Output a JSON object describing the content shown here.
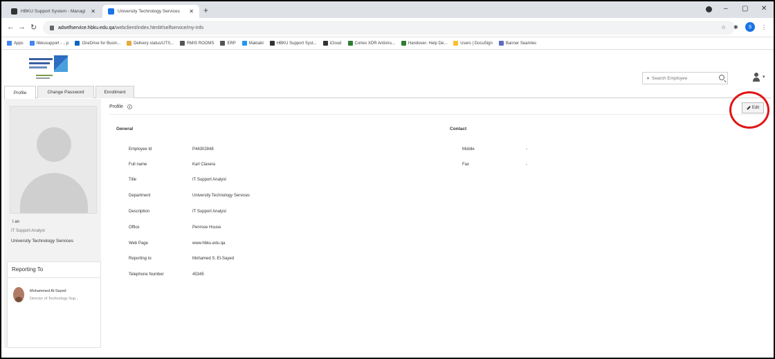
{
  "browser": {
    "tabs": [
      {
        "title": "HBKU Support System - Managi",
        "active": false,
        "favicon_color": "#333333"
      },
      {
        "title": "University Technology Services",
        "active": true,
        "favicon_color": "#1a73e8"
      }
    ],
    "new_tab": "+",
    "window_controls": {
      "minimize": "–",
      "maximize": "▢",
      "close": "✕"
    },
    "address": {
      "domain": "adselfservice.hbku.edu.qa",
      "path": "/webclient/index.html#/selfservice/my-info"
    },
    "account_initial": "S",
    "bookmarks": [
      {
        "label": "Apps",
        "color": "#4285f4"
      },
      {
        "label": "hbkusupport - ...p",
        "color": "#4285f4"
      },
      {
        "label": "OneDrive for Busin...",
        "color": "#0a66c2"
      },
      {
        "label": "Delivery status/UTS...",
        "color": "#e8a93a"
      },
      {
        "label": "RMIS ROOMS",
        "color": "#555555"
      },
      {
        "label": "ERP",
        "color": "#555555"
      },
      {
        "label": "Maktabi",
        "color": "#2196f3"
      },
      {
        "label": "HBKU Support Syst...",
        "color": "#333333"
      },
      {
        "label": "iCloud",
        "color": "#333333"
      },
      {
        "label": "Cortex XDR Antiviru...",
        "color": "#2e7d32"
      },
      {
        "label": "Handover- Help De...",
        "color": "#2e7d32"
      },
      {
        "label": "Users | DocuSign",
        "color": "#fbc02d"
      },
      {
        "label": "Banner Seamles",
        "color": "#5c6bc0"
      }
    ]
  },
  "header": {
    "search_placeholder": "Search Employee"
  },
  "tabs": [
    "Profile",
    "Change Password",
    "Enrollment"
  ],
  "sidebar": {
    "name": "I    an",
    "title": "IT Support Analyst",
    "department": "University Technology Services",
    "reporting_heading": "Reporting To",
    "manager_name": "Mohammed Al-Sayed",
    "manager_title": "Director of Technology Sup..."
  },
  "profile": {
    "heading": "Profile",
    "edit_label": "Edit",
    "general_heading": "General",
    "contact_heading": "Contact",
    "general": [
      {
        "label": "Employee Id",
        "value": "P44302848"
      },
      {
        "label": "Full name",
        "value": "Karl Clavera"
      },
      {
        "label": "Title",
        "value": "IT Support Analyst"
      },
      {
        "label": "Department",
        "value": "University Technology Services"
      },
      {
        "label": "Description",
        "value": "IT Support Analyst"
      },
      {
        "label": "Office",
        "value": "Penrose House"
      },
      {
        "label": "Web Page",
        "value": "www.hbku.edu.qa"
      },
      {
        "label": "Reporting to",
        "value": "Mohamed S. El-Sayed"
      },
      {
        "label": "Telephone Number",
        "value": "45345"
      }
    ],
    "contact": [
      {
        "label": "Mobile",
        "value": "-"
      },
      {
        "label": "Fax",
        "value": "-"
      }
    ]
  },
  "annotation_color": "#e01515"
}
